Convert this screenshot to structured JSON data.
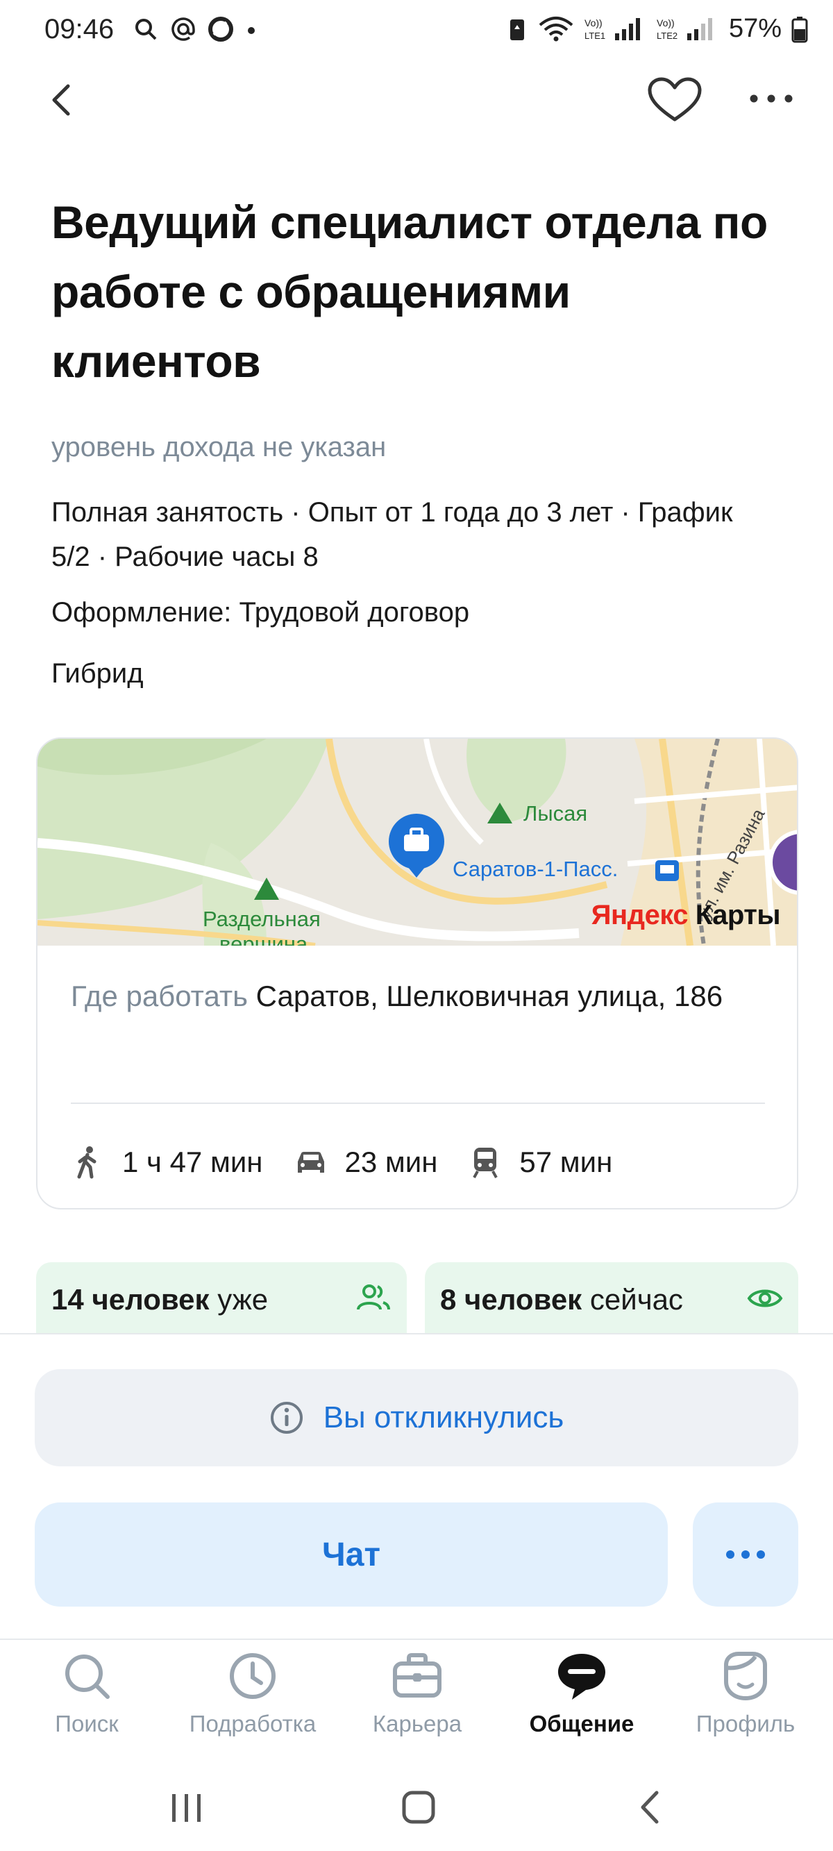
{
  "status_bar": {
    "time": "09:46",
    "battery": "57%",
    "sim1_label": "Vo)) LTE1",
    "sim2_label": "Vo)) LTE2"
  },
  "nav": {
    "back_icon": "chevron-left-icon",
    "favorite_icon": "heart-icon",
    "more_icon": "more-horizontal-icon"
  },
  "job": {
    "title": "Ведущий специалист отдела по работе с обращениями клиентов",
    "salary": "уровень дохода не указан",
    "details": "Полная занятость · Опыт от 1 года до 3 лет · График 5/2 · Рабочие часы 8",
    "contract": "Оформление: Трудовой договор",
    "work_format": "Гибрид"
  },
  "map": {
    "labels": {
      "peak_1": "Лысая",
      "peak_2_line1": "Раздельная",
      "peak_2_line2": "вершина",
      "station": "Саратов-1-Пасс.",
      "street": "ул. им. Разина"
    },
    "logo_part1": "Яндекс",
    "logo_part2": "Карты",
    "address_label": "Где работать",
    "address_value": "Саратов, Шелковичная улица, 186",
    "travel": {
      "walk": "1 ч 47 мин",
      "car": "23 мин",
      "transit": "57 мин"
    }
  },
  "stats": {
    "chip1_bold": "14 человек",
    "chip1_rest": "уже",
    "chip2_bold": "8 человек",
    "chip2_rest": "сейчас"
  },
  "actions": {
    "responded": "Вы откликнулись",
    "chat": "Чат"
  },
  "bottom_nav": [
    {
      "label": "Поиск",
      "icon": "search-icon"
    },
    {
      "label": "Подработка",
      "icon": "clock-icon"
    },
    {
      "label": "Карьера",
      "icon": "briefcase-icon"
    },
    {
      "label": "Общение",
      "icon": "chat-icon",
      "active": true
    },
    {
      "label": "Профиль",
      "icon": "profile-icon"
    }
  ],
  "colors": {
    "accent": "#1d72d6",
    "chip_bg": "#e8f7ed",
    "muted": "#7d8a97",
    "peak_green": "#2c8a3b"
  }
}
